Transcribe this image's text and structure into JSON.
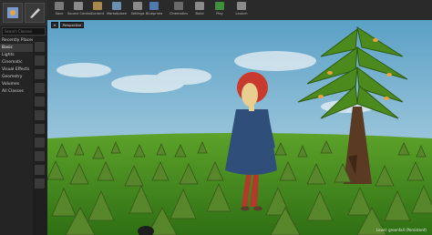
{
  "modes": {
    "search_placeholder": "Search Classes",
    "categories": [
      "Recently Placed",
      "Basic",
      "Lights",
      "Cinematic",
      "Visual Effects",
      "Geometry",
      "Volumes",
      "All Classes"
    ],
    "selected_category": "Basic"
  },
  "toolbar": {
    "buttons": [
      {
        "label": "Save",
        "icon": "save-icon"
      },
      {
        "label": "Source Control",
        "icon": "source-control-icon"
      },
      {
        "label": "Content",
        "icon": "content-icon"
      },
      {
        "label": "Marketplace",
        "icon": "marketplace-icon"
      },
      {
        "label": "Settings",
        "icon": "settings-icon"
      },
      {
        "label": "Blueprints",
        "icon": "blueprints-icon"
      },
      {
        "label": "Cinematics",
        "icon": "cinematics-icon"
      },
      {
        "label": "Build",
        "icon": "build-icon"
      },
      {
        "label": "Play",
        "icon": "play-icon"
      },
      {
        "label": "Launch",
        "icon": "launch-icon"
      }
    ]
  },
  "viewport": {
    "view_mode": "Perspective",
    "level_label": "Level: greenfall (Persistent)"
  },
  "colors": {
    "accent": "#e8a33a",
    "sky_top": "#5fa3c8",
    "grass": "#3f8a1e"
  }
}
